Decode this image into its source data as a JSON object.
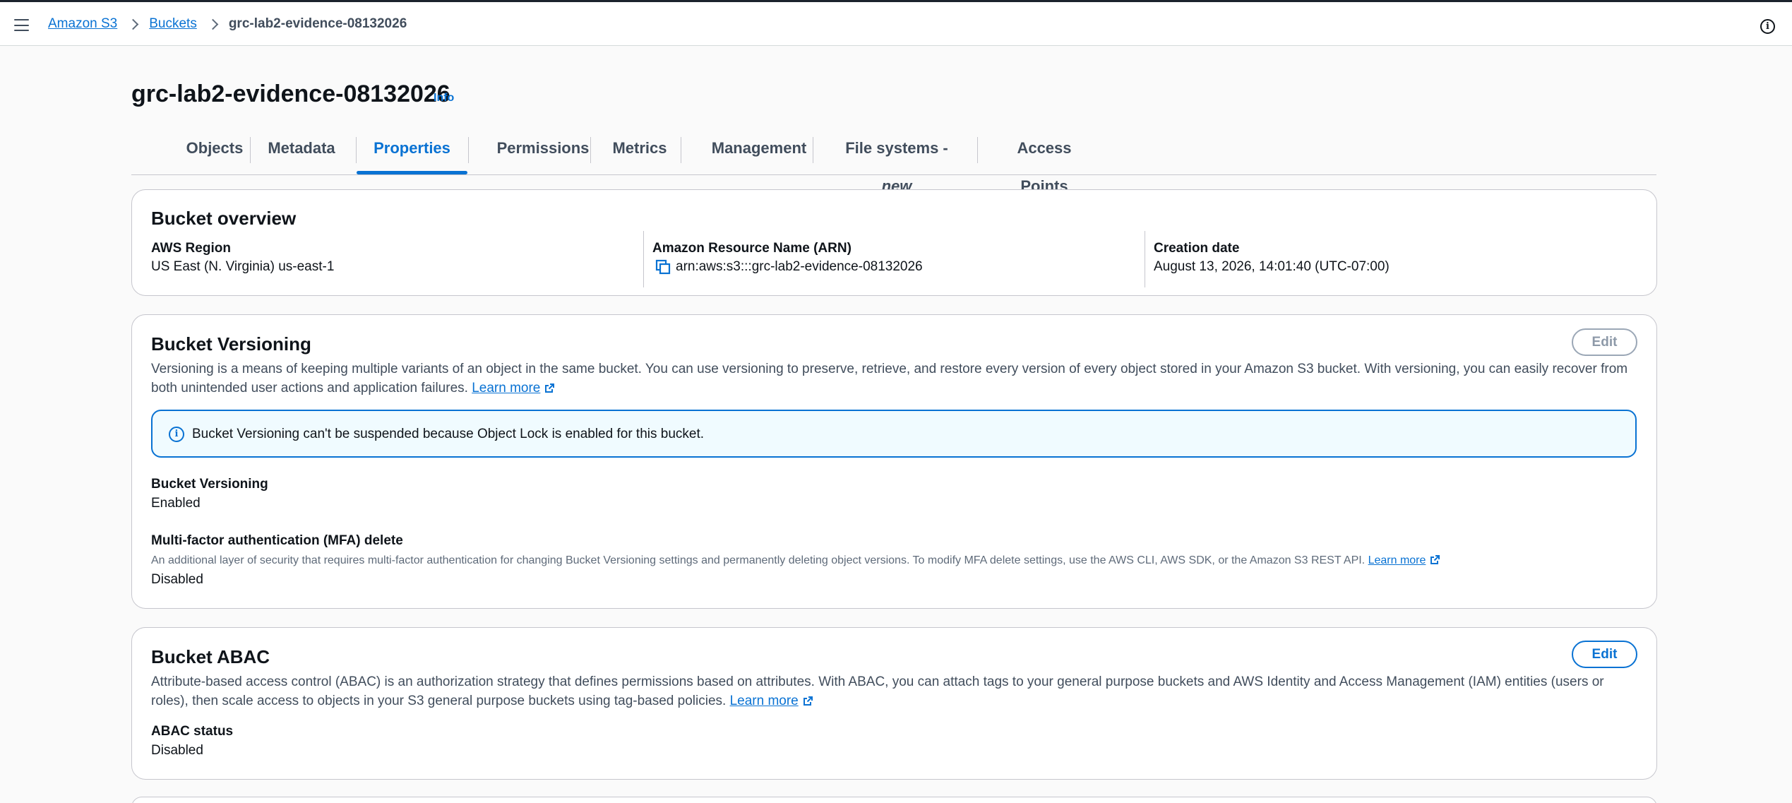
{
  "breadcrumb": {
    "items": [
      "Amazon S3",
      "Buckets"
    ],
    "current": "grc-lab2-evidence-08132026"
  },
  "header": {
    "title": "grc-lab2-evidence-08132026",
    "info_label": "Info"
  },
  "tabs": [
    {
      "label": "Objects"
    },
    {
      "label": "Metadata"
    },
    {
      "label": "Properties",
      "active": true
    },
    {
      "label": "Permissions"
    },
    {
      "label": "Metrics"
    },
    {
      "label": "Management"
    },
    {
      "label": "File systems - ",
      "suffix": "new"
    },
    {
      "label": "Access Points"
    }
  ],
  "overview": {
    "title": "Bucket overview",
    "region_label": "AWS Region",
    "region_value": "US East (N. Virginia) us-east-1",
    "arn_label": "Amazon Resource Name (ARN)",
    "arn_value": "arn:aws:s3:::grc-lab2-evidence-08132026",
    "created_label": "Creation date",
    "created_value": "August 13, 2026, 14:01:40 (UTC-07:00)"
  },
  "versioning": {
    "title": "Bucket Versioning",
    "edit_label": "Edit",
    "description": "Versioning is a means of keeping multiple variants of an object in the same bucket. You can use versioning to preserve, retrieve, and restore every version of every object stored in your Amazon S3 bucket. With versioning, you can easily recover from both unintended user actions and application failures.",
    "learn_more": "Learn more",
    "alert": "Bucket Versioning can't be suspended because Object Lock is enabled for this bucket.",
    "status_label": "Bucket Versioning",
    "status_value": "Enabled",
    "mfa_label": "Multi-factor authentication (MFA) delete",
    "mfa_description": "An additional layer of security that requires multi-factor authentication for changing Bucket Versioning settings and permanently deleting object versions. To modify MFA delete settings, use the AWS CLI, AWS SDK, or the Amazon S3 REST API.",
    "mfa_learn_more": "Learn more",
    "mfa_value": "Disabled"
  },
  "abac": {
    "title": "Bucket ABAC",
    "edit_label": "Edit",
    "description": "Attribute-based access control (ABAC) is an authorization strategy that defines permissions based on attributes. With ABAC, you can attach tags to your general purpose buckets and AWS Identity and Access Management (IAM) entities (users or roles), then scale access to objects in your S3 general purpose buckets using tag-based policies.",
    "learn_more": "Learn more",
    "status_label": "ABAC status",
    "status_value": "Disabled"
  },
  "colors": {
    "accent": "#0972d3",
    "text": "#0f141a",
    "alert_bg": "#f0fbff"
  }
}
